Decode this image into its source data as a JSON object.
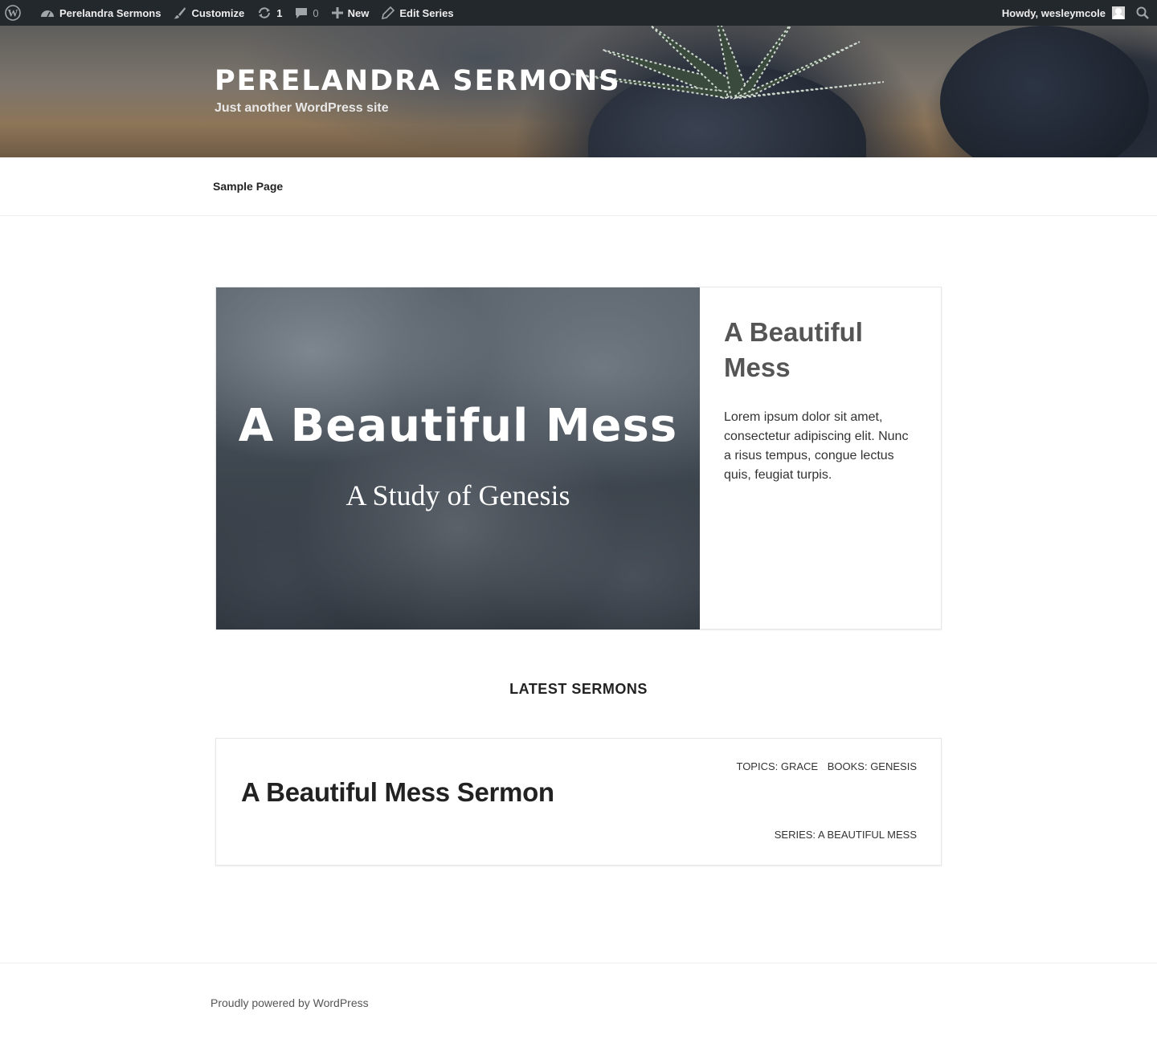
{
  "admin_bar": {
    "site_name": "Perelandra Sermons",
    "customize": "Customize",
    "updates_count": "1",
    "comments_count": "0",
    "new_label": "New",
    "edit_label": "Edit Series",
    "greeting": "Howdy, wesleymcole"
  },
  "header": {
    "title": "PERELANDRA SERMONS",
    "tagline": "Just another WordPress site"
  },
  "nav": {
    "items": [
      {
        "label": "Sample Page"
      }
    ]
  },
  "featured_series": {
    "image_title": "A Beautiful Mess",
    "image_subtitle": "A Study of Genesis",
    "title": "A Beautiful Mess",
    "excerpt": "Lorem ipsum dolor sit amet, consectetur adipiscing elit. Nunc a risus tempus, congue lectus quis, feugiat turpis."
  },
  "latest_sermons": {
    "heading": "LATEST SERMONS",
    "items": [
      {
        "title": "A Beautiful Mess Sermon",
        "topics": "TOPICS: GRACE",
        "books": "BOOKS: GENESIS",
        "series": "SERIES: A BEAUTIFUL MESS"
      }
    ]
  },
  "footer": {
    "credit": "Proudly powered by WordPress"
  },
  "colors": {
    "admin_bar_bg": "#23282d",
    "text_dark": "#222222",
    "feature_title": "#555555"
  },
  "icons": [
    "wordpress-logo-icon",
    "dashboard-icon",
    "brush-icon",
    "updates-icon",
    "comment-icon",
    "plus-icon",
    "pencil-icon",
    "avatar-icon",
    "search-icon"
  ]
}
